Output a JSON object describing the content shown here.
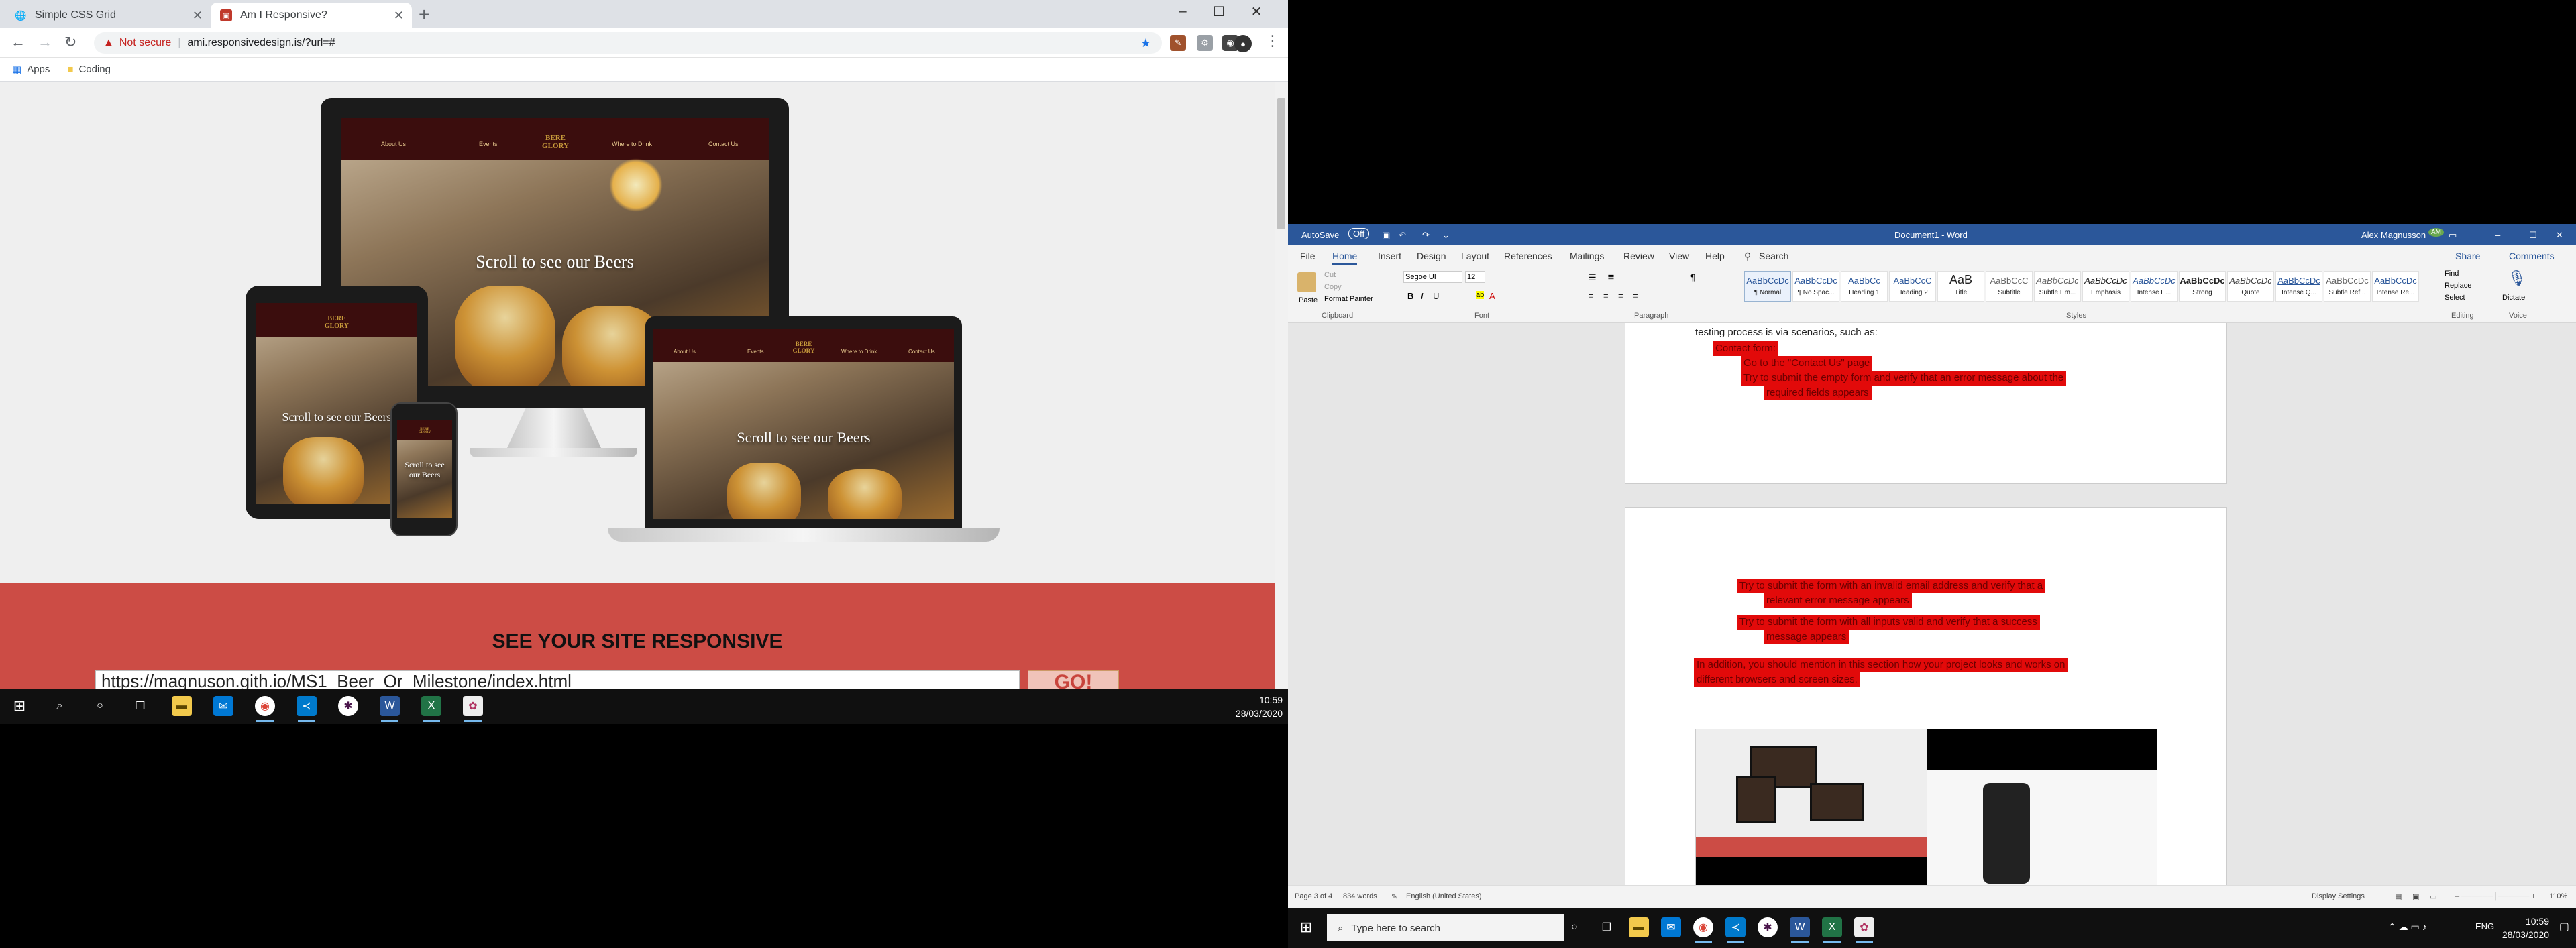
{
  "browser": {
    "tabs": [
      {
        "label": "Simple CSS Grid",
        "icon": "globe-icon",
        "active": false
      },
      {
        "label": "Am I Responsive?",
        "icon": "ami-favicon",
        "active": true
      }
    ],
    "window_controls": {
      "minimize": "–",
      "maximize": "☐",
      "close": "✕"
    },
    "url": {
      "security_label": "Not secure",
      "address": "ami.responsivedesign.is/?url=#"
    },
    "bookmarks": [
      {
        "label": "Apps",
        "icon": "apps-grid-icon"
      },
      {
        "label": "Coding",
        "icon": "folder-icon"
      }
    ]
  },
  "page": {
    "mockup_caption": "Scroll to see our Beers",
    "logo_text": "BERE GLORY",
    "nav_links": [
      "About Us",
      "Events",
      "Where to Drink",
      "Contact Us"
    ],
    "cta_heading": "SEE YOUR SITE RESPONSIVE",
    "url_input_value": "https://magnuson.gith.io/MS1_Beer_Or_Milestone/index.html",
    "go_button": "GO!"
  },
  "taskbar_left": {
    "time": "10:59",
    "date": "28/03/2020",
    "apps": [
      "start",
      "search",
      "cortana",
      "task-view",
      "file-explorer",
      "mail",
      "chrome",
      "vscode",
      "slack",
      "word",
      "excel",
      "paint"
    ]
  },
  "word": {
    "autosave_label": "AutoSave",
    "autosave_state": "Off",
    "title": "Document1 - Word",
    "user": "Alex Magnusson",
    "user_initials": "AM",
    "tabs": [
      "File",
      "Home",
      "Insert",
      "Design",
      "Layout",
      "References",
      "Mailings",
      "Review",
      "View",
      "Help"
    ],
    "active_tab": "Home",
    "search_label": "Search",
    "share_label": "Share",
    "comments_label": "Comments",
    "clipboard": {
      "paste": "Paste",
      "cut": "Cut",
      "copy": "Copy",
      "format_painter": "Format Painter"
    },
    "font": {
      "name": "Segoe UI",
      "size": "12"
    },
    "groups": [
      "Clipboard",
      "Font",
      "Paragraph",
      "Styles",
      "Editing",
      "Voice"
    ],
    "styles": [
      {
        "preview": "AaBbCcDc",
        "label": "¶ Normal"
      },
      {
        "preview": "AaBbCcDc",
        "label": "¶ No Spac..."
      },
      {
        "preview": "AaBbCc",
        "label": "Heading 1"
      },
      {
        "preview": "AaBbCcC",
        "label": "Heading 2"
      },
      {
        "preview": "AaB",
        "label": "Title"
      },
      {
        "preview": "AaBbCcC",
        "label": "Subtitle"
      },
      {
        "preview": "AaBbCcDc",
        "label": "Subtle Em..."
      },
      {
        "preview": "AaBbCcDc",
        "label": "Emphasis"
      },
      {
        "preview": "AaBbCcDc",
        "label": "Intense E..."
      },
      {
        "preview": "AaBbCcDc",
        "label": "Strong"
      },
      {
        "preview": "AaBbCcDc",
        "label": "Quote"
      },
      {
        "preview": "AaBbCcDc",
        "label": "Intense Q..."
      },
      {
        "preview": "AaBbCcDc",
        "label": "Subtle Ref..."
      },
      {
        "preview": "AaBbCcDc",
        "label": "Intense Re..."
      }
    ],
    "editing": {
      "find": "Find",
      "replace": "Replace",
      "select": "Select"
    },
    "voice": {
      "dictate": "Dictate"
    },
    "doc_text": {
      "intro_fragment": "testing process is via scenarios, such as:",
      "contact_heading": "Contact form:",
      "p1_items": [
        "Go to the \"Contact Us\" page",
        "Try to submit the empty form and verify that an error message about the",
        "required fields appears"
      ],
      "p2_items": [
        "Try to submit the form with an invalid email address and verify that a",
        "relevant error message appears",
        "Try to submit the form with all inputs valid and verify that a success",
        "message appears"
      ],
      "p2_para": [
        "In addition, you should mention in this section how your project looks and works on",
        "different browsers and screen sizes."
      ]
    },
    "status": {
      "page": "Page 3 of 4",
      "words": "834 words",
      "language": "English (United States)",
      "display_settings": "Display Settings",
      "zoom": "110%"
    }
  },
  "taskbar_right": {
    "search_placeholder": "Type here to search",
    "language": "ENG",
    "time": "10:59",
    "date": "28/03/2020"
  }
}
